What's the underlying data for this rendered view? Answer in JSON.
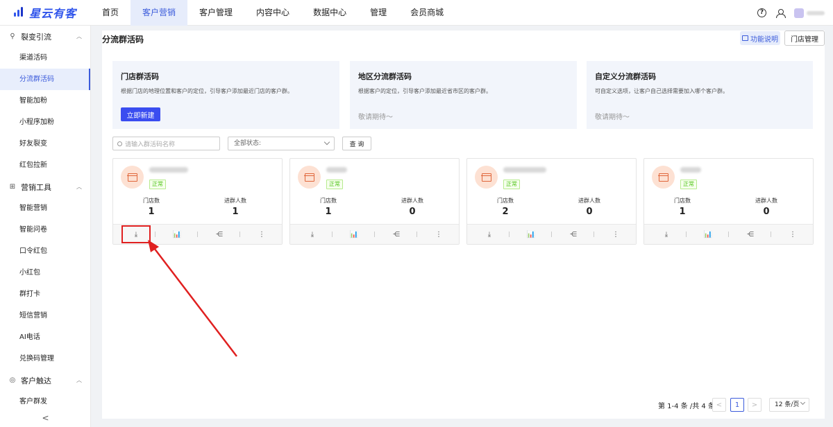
{
  "app": {
    "logo_text": "星云有客"
  },
  "nav": [
    {
      "label": "首页"
    },
    {
      "label": "客户营销",
      "active": true
    },
    {
      "label": "客户管理"
    },
    {
      "label": "内容中心"
    },
    {
      "label": "数据中心"
    },
    {
      "label": "管理"
    },
    {
      "label": "会员商城"
    }
  ],
  "top_icons": {
    "help": "?",
    "user": "user-icon"
  },
  "sidebar": {
    "groups": [
      {
        "label": "裂变引流",
        "icon": "share-icon",
        "items": [
          "渠道活码",
          "分流群活码",
          "智能加粉",
          "小程序加粉",
          "好友裂变",
          "红包拉新"
        ]
      },
      {
        "label": "营销工具",
        "icon": "gift-icon",
        "items": [
          "智能营销",
          "智能问卷",
          "口令红包",
          "小红包",
          "群打卡",
          "短信营销",
          "AI电话",
          "兑换码管理"
        ]
      },
      {
        "label": "客户触达",
        "icon": "target-icon",
        "items": [
          "客户群发"
        ]
      }
    ],
    "active_item": "分流群活码",
    "collapse": "<"
  },
  "page": {
    "title": "分流群活码",
    "func_button": "功能说明",
    "store_button": "门店管理"
  },
  "types": [
    {
      "title": "门店群活码",
      "desc": "根据门店的地理位置和客户的定位，引导客户添加最近门店的客户群。",
      "action": "立即新建"
    },
    {
      "title": "地区分流群活码",
      "desc": "根据客户的定位，引导客户添加最近省市区的客户群。",
      "soon": "敬请期待～"
    },
    {
      "title": "自定义分流群活码",
      "desc": "可自定义选项，让客户自己选择需要加入哪个客户群。",
      "soon": "敬请期待～"
    }
  ],
  "filters": {
    "search_placeholder": "请输入群活码名称",
    "status": "全部状态:",
    "query": "查 询"
  },
  "cards": [
    {
      "status": "正常",
      "label_stores": "门店数",
      "stores": "1",
      "label_joined": "进群人数",
      "joined": "1"
    },
    {
      "status": "正常",
      "label_stores": "门店数",
      "stores": "1",
      "label_joined": "进群人数",
      "joined": "0"
    },
    {
      "status": "正常",
      "label_stores": "门店数",
      "stores": "2",
      "label_joined": "进群人数",
      "joined": "0"
    },
    {
      "status": "正常",
      "label_stores": "门店数",
      "stores": "1",
      "label_joined": "进群人数",
      "joined": "0"
    }
  ],
  "card_tools": [
    "download-icon",
    "chart-icon",
    "share-icon",
    "more-icon"
  ],
  "pagination": {
    "total": "第 1-4 条 /共 4 条",
    "prev": "<",
    "current": "1",
    "next": ">",
    "page_size": "12 条/页"
  },
  "colors": {
    "accent": "#3a4df0",
    "active_bg": "#e6ecfb",
    "annotation": "#e02020"
  }
}
